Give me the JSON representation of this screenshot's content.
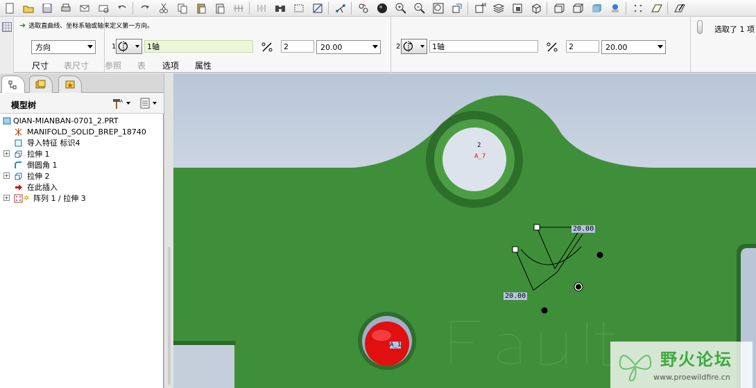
{
  "toolbar": {
    "icons": [
      "new-icon",
      "open-icon",
      "save-icon",
      "print-icon",
      "email-icon",
      "email-attach-icon",
      "undo-icon",
      "redo-icon",
      "cut-icon",
      "copy-icon",
      "paste-icon",
      "paste-special-icon",
      "regenerate-icon",
      "regenerate-manager-icon",
      "find-icon",
      "select-box-icon",
      "datum-display-icon",
      "datum-axis-icon",
      "spin-center-icon",
      "appearance-icon",
      "zoom-in-icon",
      "zoom-out-icon",
      "refit-icon",
      "reorient-icon",
      "saved-views-icon",
      "layers-icon",
      "view-manager-icon",
      "wireframe-icon",
      "hidden-line-icon",
      "no-hidden-icon",
      "shading-icon",
      "model-tree-icon",
      "settings-icon",
      "datum-plane-icon",
      "sketch-icon"
    ]
  },
  "dashboard": {
    "prompt": "选取直曲线、坐标系轴或轴来定义第一方向。",
    "direction_select": "方向",
    "axis1": {
      "index": "1",
      "reference": "1轴",
      "count": "2",
      "spacing": "20.00"
    },
    "axis2": {
      "index": "2",
      "reference": "1轴",
      "count": "2",
      "spacing": "20.00"
    },
    "selection_status": "选取了 1 项",
    "tabs": [
      {
        "label": "尺寸",
        "enabled": true
      },
      {
        "label": "表尺寸",
        "enabled": false
      },
      {
        "label": "参照",
        "enabled": false
      },
      {
        "label": "表",
        "enabled": false
      },
      {
        "label": "选项",
        "enabled": true
      },
      {
        "label": "属性",
        "enabled": true
      }
    ]
  },
  "model_tree": {
    "title": "模型树",
    "items": [
      {
        "label": "QIAN-MIANBAN-0701_2.PRT",
        "icon": "part-icon",
        "expandable": false
      },
      {
        "label": "MANIFOLD_SOLID_BREP_18740",
        "icon": "csys-icon",
        "expandable": false
      },
      {
        "label": "导入特征 标识4",
        "icon": "import-feature-icon",
        "expandable": false
      },
      {
        "label": "拉伸 1",
        "icon": "extrude-icon",
        "expandable": true
      },
      {
        "label": "倒圆角 1",
        "icon": "round-icon",
        "expandable": false
      },
      {
        "label": "拉伸 2",
        "icon": "extrude-icon",
        "expandable": true
      },
      {
        "label": "在此插入",
        "icon": "insert-here-icon",
        "expandable": false
      },
      {
        "label": "阵列 1 / 拉伸 3",
        "icon": "pattern-icon",
        "expandable": true
      }
    ]
  },
  "viewport": {
    "dimension_top": "20.00",
    "dimension_bottom": "20.00",
    "axis_label": "A_7",
    "axis_number": "2",
    "selected_axis_label": "A_1",
    "model_color": "#3f8f3a",
    "selection_color": "#e01010"
  },
  "watermark": {
    "title": "野火论坛",
    "url": "www.proewildfire.cn"
  }
}
